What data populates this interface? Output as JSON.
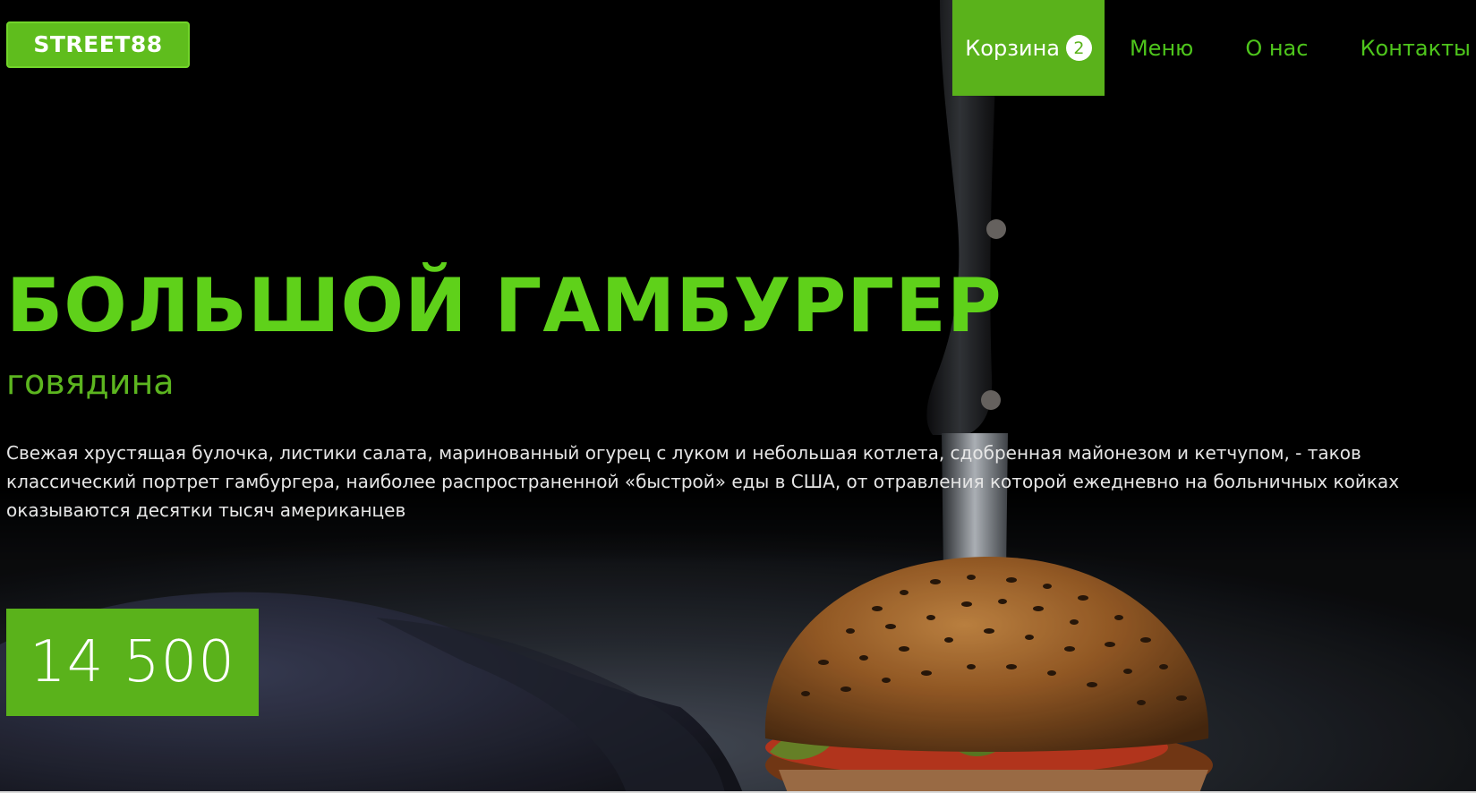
{
  "header": {
    "logo": "STREET88",
    "nav": {
      "cart_label": "Корзина",
      "cart_count": "2",
      "menu_label": "Меню",
      "about_label": "О нас",
      "contacts_label": "Контакты"
    }
  },
  "hero": {
    "title": "БОЛЬШОЙ ГАМБУРГЕР",
    "subtitle": "говядина",
    "description": "Свежая хрустящая булочка, листики салата, маринованный огурец с луком и небольшая котлета, сдобренная майонезом и кетчупом, - таков классический портрет гамбургера, наиболее распространенной «быстрой» еды в США, от отравления которой ежедневно на больничных койках оказываются десятки тысяч американцев",
    "price": "14 500"
  },
  "colors": {
    "accent": "#5ab21b",
    "title": "#5fd11a",
    "background": "#000000"
  },
  "icons": {
    "hero_image": "burger-with-knife-photo"
  }
}
